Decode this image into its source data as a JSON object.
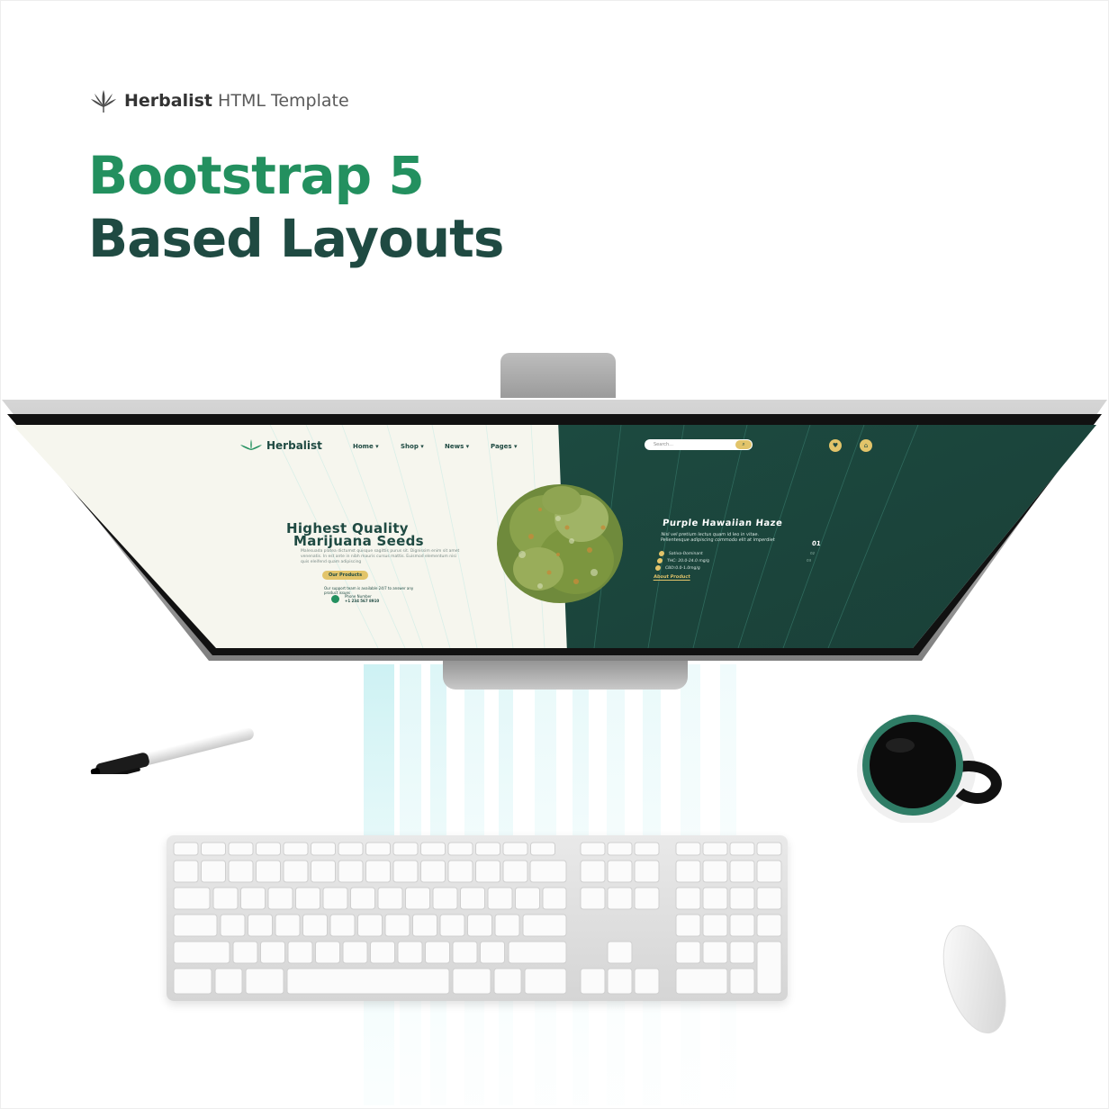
{
  "header": {
    "brand_name": "Herbalist",
    "brand_suffix": "HTML Template",
    "headline_line1": "Bootstrap 5",
    "headline_line2": "Based Layouts"
  },
  "screen": {
    "logo": "Herbalist",
    "nav": [
      "Home ▾",
      "Shop ▾",
      "News ▾",
      "Pages ▾"
    ],
    "search_placeholder": "Search...",
    "hero_line1": "Highest Quality",
    "hero_line2": "Marijuana Seeds",
    "hero_paragraph": "Malesuada platea dictumst quisque sagittis purus sit. Dignissim enim sit amet venenatis. In est ante in nibh mauris cursus mattis. Euismod elementum nisi quis eleifend quam adipiscing",
    "cta_label": "Our Products",
    "support_text": "Our support team is available 24/7 to answer any product issues",
    "phone_label": "Phone Number",
    "phone_number": "+1 234 567 8910",
    "product_title": "Purple Hawaiian Haze",
    "product_desc": "Nisl vel pretium lectus quam id leo in vitae. Pellentesque adipiscing commodo elit at imperdiet",
    "product_index": "01",
    "specs": [
      {
        "label": "Sativa-Dominant",
        "num": "02"
      },
      {
        "label": "THC: 20.0-24.0 mg/g",
        "num": "03"
      },
      {
        "label": "CBD:0.0-1.0mg/g",
        "num": ""
      }
    ],
    "about_link": "About Product"
  },
  "colors": {
    "green": "#23905f",
    "dark_green": "#1f4a42",
    "gold": "#e2c46a",
    "screen_bg_light": "#f6f6ee"
  },
  "icons": {
    "brand": "cannabis-leaf-icon",
    "search": "search-icon",
    "heart": "heart-icon",
    "cart": "cart-icon"
  }
}
